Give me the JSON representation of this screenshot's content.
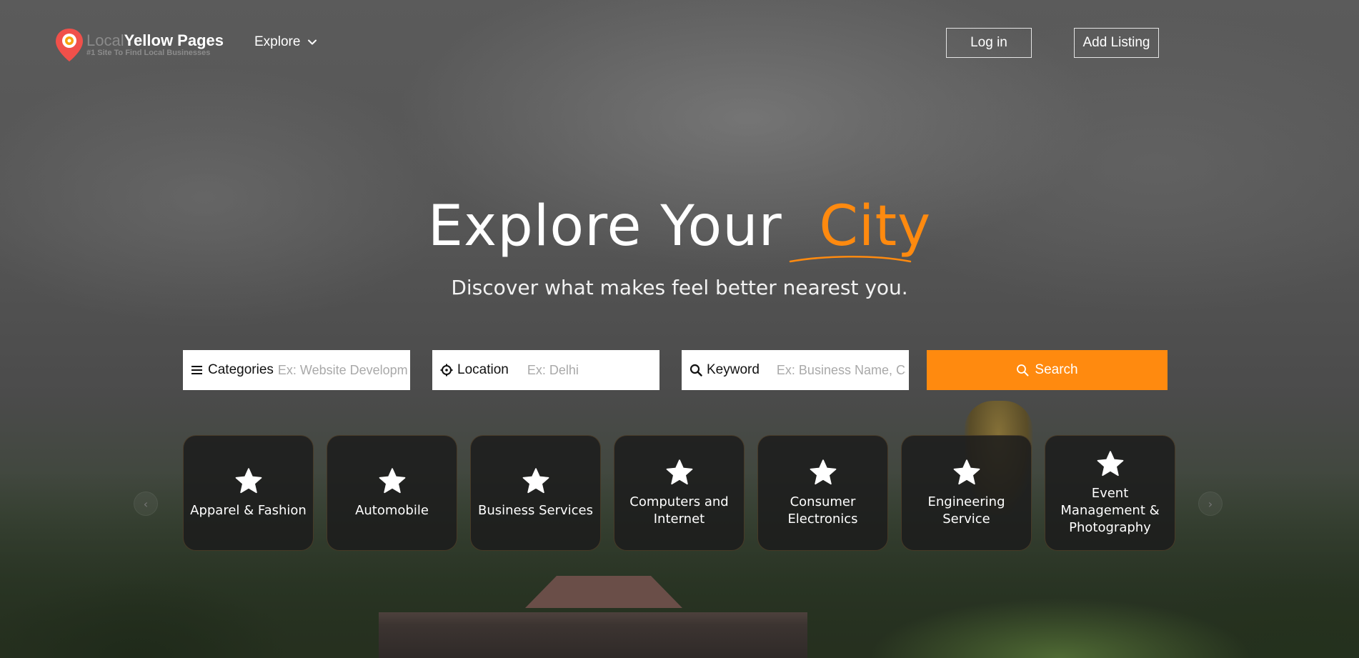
{
  "header": {
    "logo": {
      "title_light": "Local",
      "title_bold": "Yellow Pages",
      "tagline": "#1 Site To Find Local Businesses",
      "icon": "map-pin-icon"
    },
    "nav": {
      "explore_label": "Explore",
      "explore_icon": "chevron-down-icon"
    },
    "login_label": "Log in",
    "add_listing_label": "Add Listing"
  },
  "hero": {
    "title_main": "Explore Your",
    "title_accent": "City",
    "subtitle": "Discover what makes feel better nearest you.",
    "accent_color": "#ff8a0f"
  },
  "search": {
    "categories": {
      "label": "Categories",
      "icon": "menu-icon",
      "placeholder": "Ex: Website Development",
      "value": ""
    },
    "location": {
      "label": "Location",
      "icon": "crosshair-icon",
      "placeholder": "Ex: Delhi",
      "value": ""
    },
    "keyword": {
      "label": "Keyword",
      "icon": "search-icon",
      "placeholder": "Ex: Business Name, Category",
      "value": ""
    },
    "button_label": "Search",
    "button_color": "#ff8a0f"
  },
  "categories": {
    "prev_arrow": "‹",
    "next_arrow": "›",
    "items": [
      {
        "label": "Apparel & Fashion",
        "icon": "star-icon"
      },
      {
        "label": "Automobile",
        "icon": "star-icon"
      },
      {
        "label": "Business Services",
        "icon": "star-icon"
      },
      {
        "label": "Computers and Internet",
        "icon": "star-icon"
      },
      {
        "label": "Consumer Electronics",
        "icon": "star-icon"
      },
      {
        "label": "Engineering Service",
        "icon": "star-icon"
      },
      {
        "label": "Event Management & Photography",
        "icon": "star-icon"
      }
    ]
  }
}
